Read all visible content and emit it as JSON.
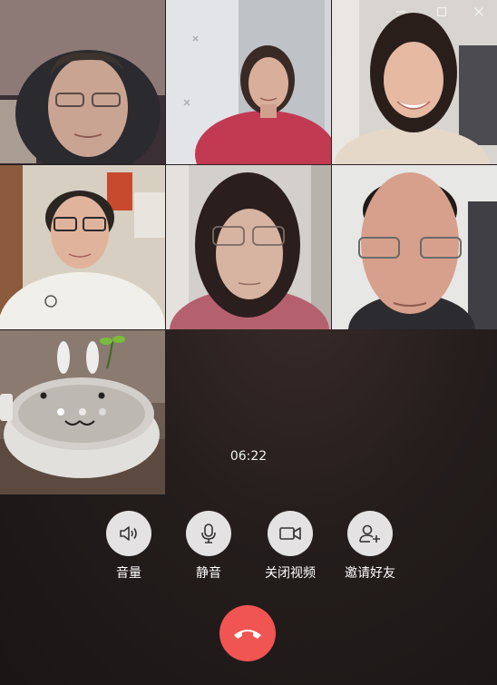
{
  "call": {
    "duration": "06:22"
  },
  "window": {
    "pin_icon": "pin-icon",
    "minimize_icon": "minimize-icon",
    "maximize_icon": "maximize-icon",
    "close_icon": "close-icon"
  },
  "controls": {
    "volume_label": "音量",
    "mute_label": "静音",
    "video_off_label": "关闭视频",
    "invite_label": "邀请好友",
    "hangup_icon": "phone-hangup-icon"
  },
  "participants": [
    {
      "id": 1,
      "shirt": "#2a2a2e",
      "bg": "#8a6f6a"
    },
    {
      "id": 2,
      "shirt": "#c23a52",
      "bg": "#cfd2d6"
    },
    {
      "id": 3,
      "shirt": "#e8ddd2",
      "bg": "#dcdad6"
    },
    {
      "id": 4,
      "shirt": "#f1efe9",
      "bg": "#d9d2c3"
    },
    {
      "id": 5,
      "shirt": "#b5606e",
      "bg": "#d6d3cf"
    },
    {
      "id": 6,
      "shirt": "#2c2c30",
      "bg": "#e6e6e4"
    },
    {
      "id": 7,
      "shirt": "",
      "bg": "#6e5c52"
    }
  ],
  "colors": {
    "hangup": "#f05552",
    "control_bg": "#e4e2e2"
  }
}
